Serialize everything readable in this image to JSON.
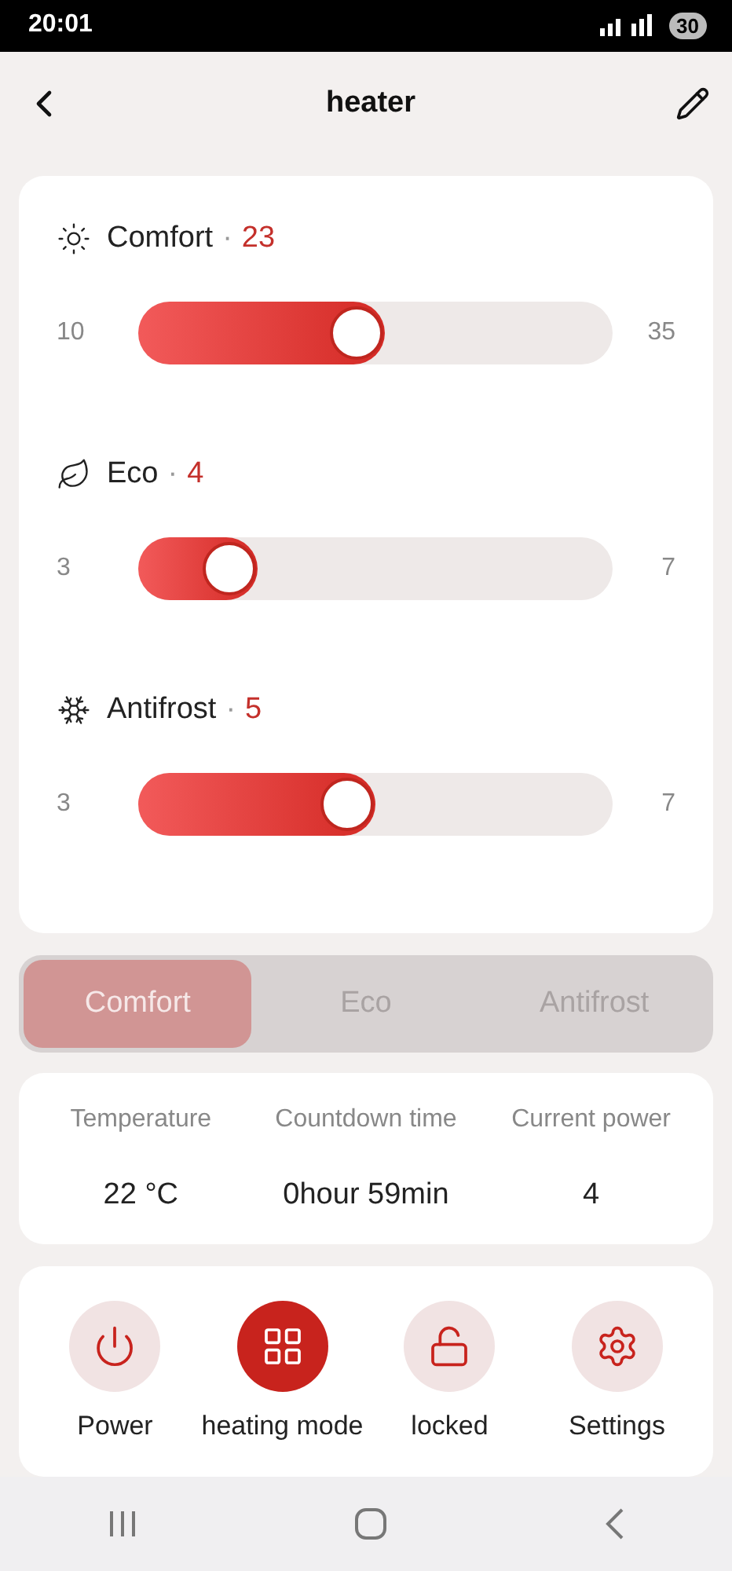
{
  "status_bar": {
    "time": "20:01",
    "battery": "30"
  },
  "header": {
    "title": "heater"
  },
  "modes": [
    {
      "kind": "sun",
      "label": "Comfort",
      "separator": "·",
      "value": "23",
      "min": "10",
      "max": "35",
      "level": 0.52
    },
    {
      "kind": "leaf",
      "label": "Eco",
      "separator": "·",
      "value": "4",
      "min": "3",
      "max": "7",
      "level": 0.25
    },
    {
      "kind": "snow",
      "label": "Antifrost",
      "separator": "·",
      "value": "5",
      "min": "3",
      "max": "7",
      "level": 0.5
    }
  ],
  "segments": [
    {
      "label": "Comfort",
      "selected": true
    },
    {
      "label": "Eco",
      "selected": false
    },
    {
      "label": "Antifrost",
      "selected": false
    }
  ],
  "stats": [
    {
      "label": "Temperature",
      "value": "22 °C"
    },
    {
      "label": "Countdown time",
      "value": "0hour 59min"
    },
    {
      "label": "Current power",
      "value": "4"
    }
  ],
  "actions": [
    {
      "kind": "power",
      "label": "Power",
      "selected": false
    },
    {
      "kind": "grid",
      "label": "heating mode",
      "selected": true
    },
    {
      "kind": "lock",
      "label": "locked",
      "selected": false
    },
    {
      "kind": "gear",
      "label": "Settings",
      "selected": false
    }
  ]
}
